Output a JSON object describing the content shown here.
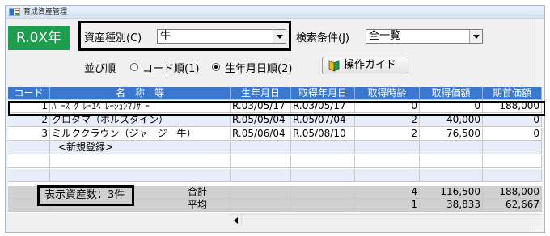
{
  "window": {
    "title": "育成資産管理"
  },
  "year_badge": "R.0X年",
  "filters": {
    "asset_type_label": "資産種別(C)",
    "asset_type_value": "牛",
    "search_label": "検索条件(J)",
    "search_value": "全一覧"
  },
  "sort": {
    "label": "並び順",
    "options": [
      "コード順(1)",
      "生年月日順(2)"
    ],
    "selected": "生年月日順(2)"
  },
  "guide_button": "操作ガイド",
  "table": {
    "columns": [
      "コード",
      "名　称　等",
      "生年月日",
      "取得年月日",
      "取得時齢",
      "取得価額",
      "期首価額"
    ],
    "rows": [
      {
        "code": "1",
        "name": "ﾊﾞｰｽﾞｸﾞﾚｰｴﾍﾞﾚｰｼｮﾝﾏﾘｻﾞｰ",
        "birth": "R.03/05/17",
        "acquired": "R.03/05/17",
        "age": "0",
        "price": "0",
        "opening": "188,000"
      },
      {
        "code": "2",
        "name": "クロタマ（ホルスタイン）",
        "birth": "R.05/05/04",
        "acquired": "R.05/07/04",
        "age": "2",
        "price": "40,000",
        "opening": "0"
      },
      {
        "code": "3",
        "name": "ミルククラウン（ジャージー牛）",
        "birth": "R.05/06/04",
        "acquired": "R.05/08/10",
        "age": "2",
        "price": "76,500",
        "opening": "0"
      }
    ],
    "new_entry": "<新規登録>",
    "summary": {
      "count_label": "表示資産数：3件",
      "total_label": "合計",
      "total_age": "4",
      "total_price": "116,500",
      "total_opening": "188,000",
      "avg_label": "平均",
      "avg_age": "1",
      "avg_price": "38,833",
      "avg_opening": "62,667"
    }
  },
  "colors": {
    "badge": "#1f9d4f",
    "header": "#3a78cf",
    "row_alt": "#e8eef9"
  }
}
